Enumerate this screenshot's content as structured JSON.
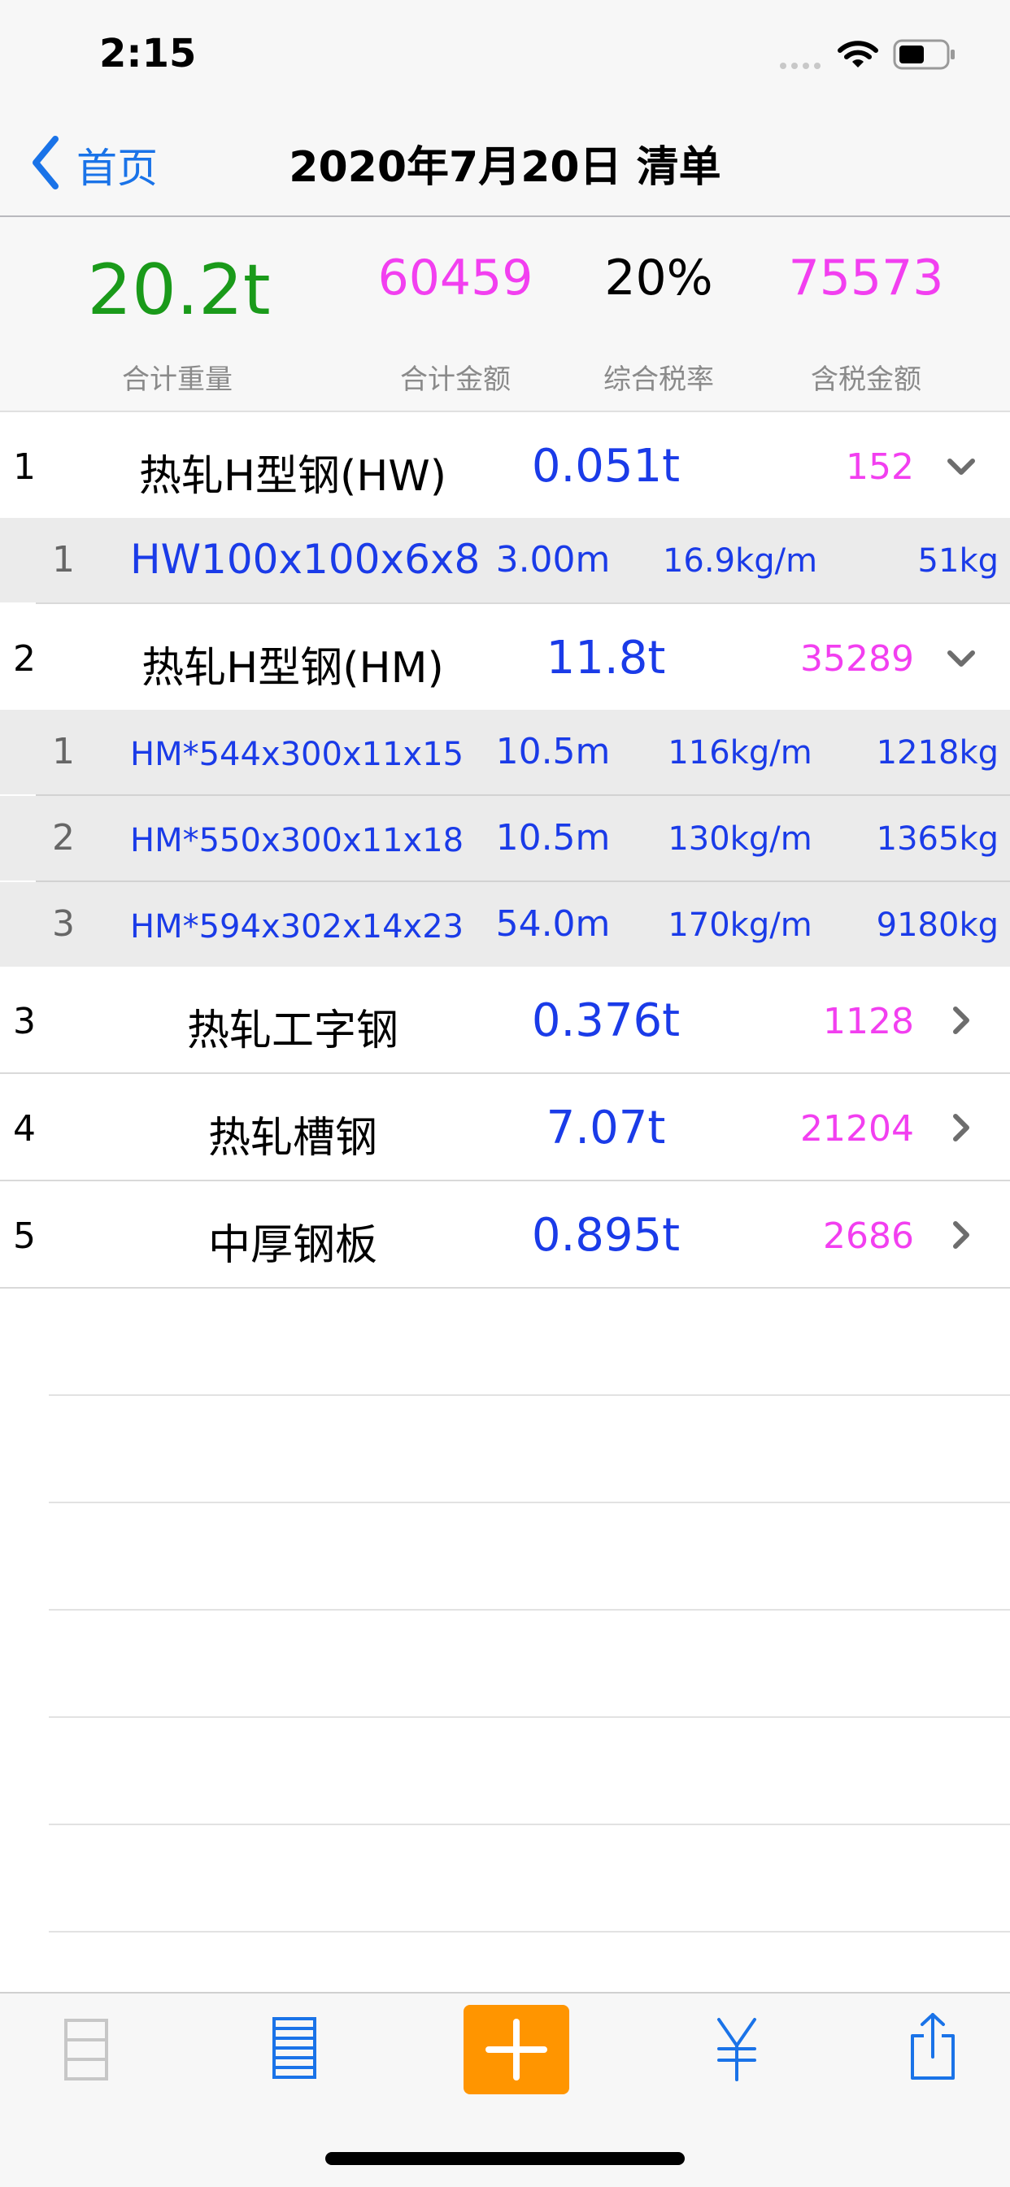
{
  "status_bar": {
    "time": "2:15"
  },
  "nav": {
    "back_label": "首页",
    "title": "2020年7月20日 清单"
  },
  "summary": {
    "total_weight": "20.2t",
    "total_weight_label": "合计重量",
    "total_amount": "60459",
    "total_amount_label": "合计金额",
    "tax_rate": "20%",
    "tax_rate_label": "综合税率",
    "amount_with_tax": "75573",
    "amount_with_tax_label": "含税金额"
  },
  "categories": [
    {
      "index": "1",
      "name": "热轧H型钢(HW)",
      "weight": "0.051t",
      "amount": "152",
      "expanded": true,
      "items": [
        {
          "index": "1",
          "spec": "HW100x100x6x8",
          "length": "3.00m",
          "unit_weight": "16.9kg/m",
          "weight": "51kg"
        }
      ]
    },
    {
      "index": "2",
      "name": "热轧H型钢(HM)",
      "weight": "11.8t",
      "amount": "35289",
      "expanded": true,
      "items": [
        {
          "index": "1",
          "spec": "HM*544x300x11x15",
          "length": "10.5m",
          "unit_weight": "116kg/m",
          "weight": "1218kg"
        },
        {
          "index": "2",
          "spec": "HM*550x300x11x18",
          "length": "10.5m",
          "unit_weight": "130kg/m",
          "weight": "1365kg"
        },
        {
          "index": "3",
          "spec": "HM*594x302x14x23",
          "length": "54.0m",
          "unit_weight": "170kg/m",
          "weight": "9180kg"
        }
      ]
    },
    {
      "index": "3",
      "name": "热轧工字钢",
      "weight": "0.376t",
      "amount": "1128",
      "expanded": false,
      "items": []
    },
    {
      "index": "4",
      "name": "热轧槽钢",
      "weight": "7.07t",
      "amount": "21204",
      "expanded": false,
      "items": []
    },
    {
      "index": "5",
      "name": "中厚钢板",
      "weight": "0.895t",
      "amount": "2686",
      "expanded": false,
      "items": []
    }
  ],
  "toolbar": {
    "items": [
      {
        "icon": "list-collapsed-icon",
        "enabled": false
      },
      {
        "icon": "list-expanded-icon",
        "enabled": true
      },
      {
        "icon": "plus-icon",
        "enabled": true
      },
      {
        "icon": "yen-icon",
        "enabled": true
      },
      {
        "icon": "share-icon",
        "enabled": true
      }
    ]
  },
  "colors": {
    "accent_blue": "#1a73e8",
    "value_blue": "#1a3be8",
    "magenta": "#f23ff0",
    "green": "#1a9a1a",
    "orange": "#ff9500",
    "gray_icon": "#c7c7c7"
  }
}
